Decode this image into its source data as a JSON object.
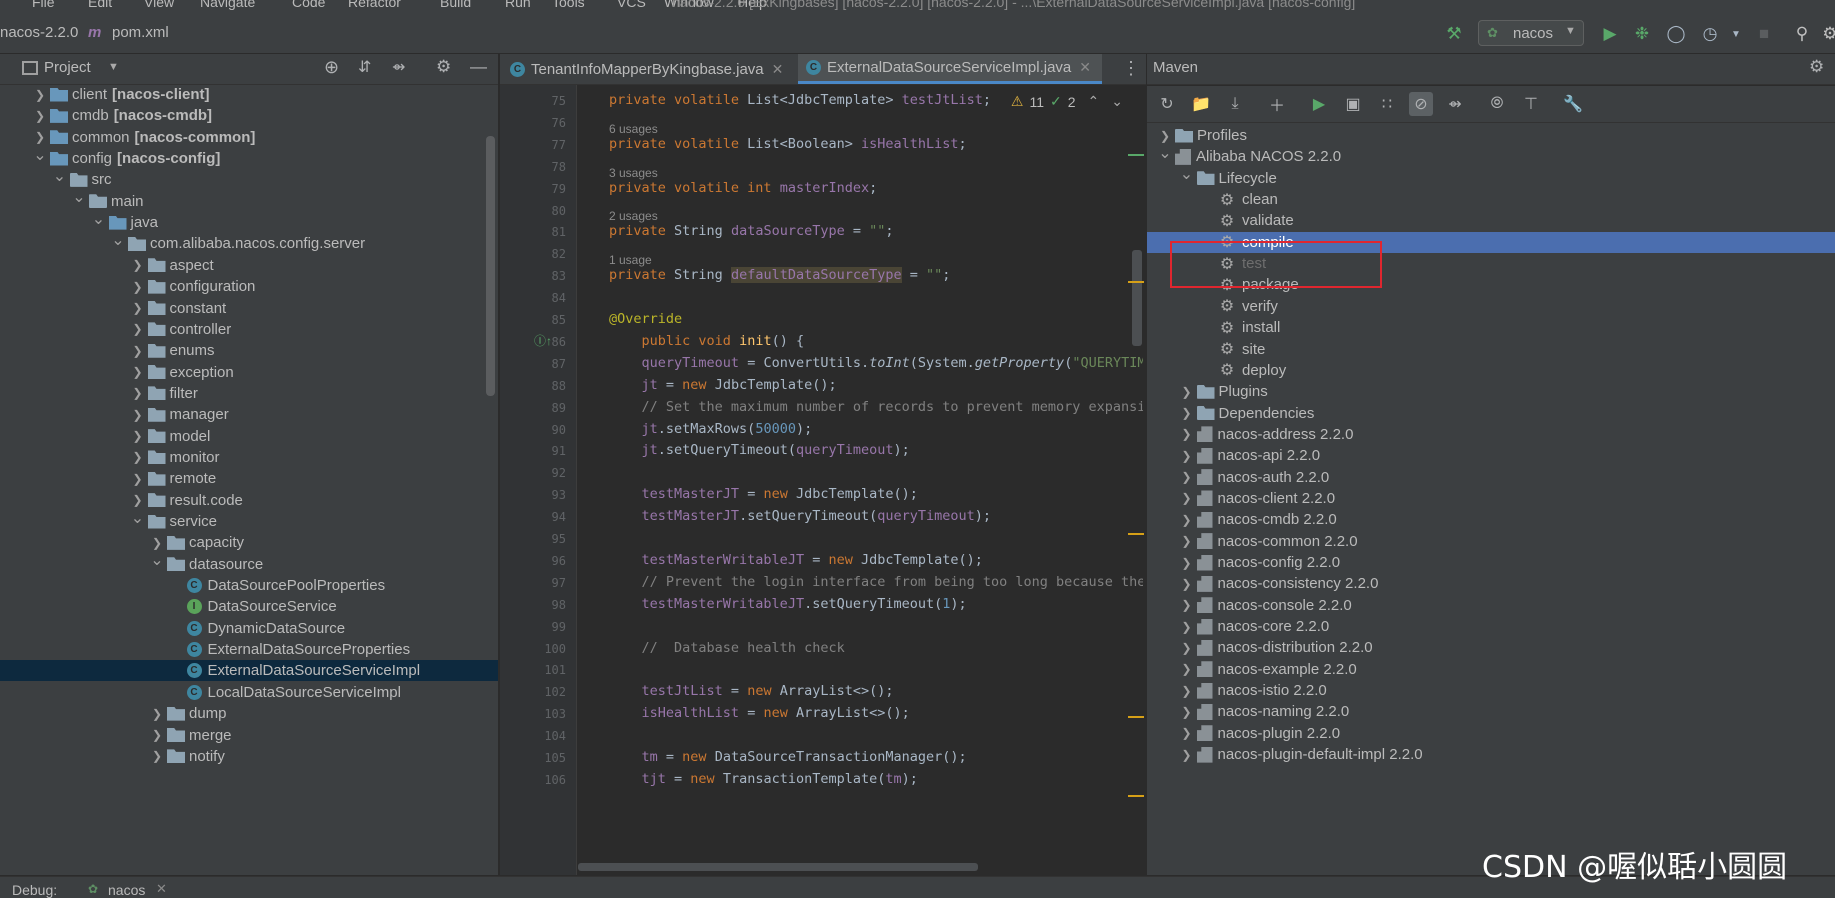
{
  "menu": [
    "File",
    "Edit",
    "View",
    "Navigate",
    "Code",
    "Refactor",
    "Build",
    "Run",
    "Tools",
    "VCS",
    "Window",
    "Help"
  ],
  "window_title": "nacos-2.2.0 [ExKingbases] [nacos-2.2.0] [nacos-2.2.0] - ...\\ExternalDataSourceServiceImpl.java [nacos-config]",
  "breadcrumb": {
    "project": "nacos-2.2.0",
    "file": "pom.xml"
  },
  "run_config": "nacos",
  "project_panel": {
    "title": "Project",
    "tree": [
      {
        "indent": 0,
        "arrow": "right",
        "icon": "folder-blue",
        "label": "client",
        "module": "[nacos-client]"
      },
      {
        "indent": 0,
        "arrow": "right",
        "icon": "folder-blue",
        "label": "cmdb",
        "module": "[nacos-cmdb]"
      },
      {
        "indent": 0,
        "arrow": "right",
        "icon": "folder-blue",
        "label": "common",
        "module": "[nacos-common]"
      },
      {
        "indent": 0,
        "arrow": "down",
        "icon": "folder-blue",
        "label": "config",
        "module": "[nacos-config]"
      },
      {
        "indent": 1,
        "arrow": "down",
        "icon": "folder",
        "label": "src"
      },
      {
        "indent": 2,
        "arrow": "down",
        "icon": "folder",
        "label": "main"
      },
      {
        "indent": 3,
        "arrow": "down",
        "icon": "folder-blue",
        "label": "java"
      },
      {
        "indent": 4,
        "arrow": "down",
        "icon": "pkg",
        "label": "com.alibaba.nacos.config.server"
      },
      {
        "indent": 5,
        "arrow": "right",
        "icon": "pkg",
        "label": "aspect"
      },
      {
        "indent": 5,
        "arrow": "right",
        "icon": "pkg",
        "label": "configuration"
      },
      {
        "indent": 5,
        "arrow": "right",
        "icon": "pkg",
        "label": "constant"
      },
      {
        "indent": 5,
        "arrow": "right",
        "icon": "pkg",
        "label": "controller"
      },
      {
        "indent": 5,
        "arrow": "right",
        "icon": "pkg",
        "label": "enums"
      },
      {
        "indent": 5,
        "arrow": "right",
        "icon": "pkg",
        "label": "exception"
      },
      {
        "indent": 5,
        "arrow": "right",
        "icon": "pkg",
        "label": "filter"
      },
      {
        "indent": 5,
        "arrow": "right",
        "icon": "pkg",
        "label": "manager"
      },
      {
        "indent": 5,
        "arrow": "right",
        "icon": "pkg",
        "label": "model"
      },
      {
        "indent": 5,
        "arrow": "right",
        "icon": "pkg",
        "label": "monitor"
      },
      {
        "indent": 5,
        "arrow": "right",
        "icon": "pkg",
        "label": "remote"
      },
      {
        "indent": 5,
        "arrow": "right",
        "icon": "pkg",
        "label": "result.code"
      },
      {
        "indent": 5,
        "arrow": "down",
        "icon": "pkg",
        "label": "service"
      },
      {
        "indent": 6,
        "arrow": "right",
        "icon": "pkg",
        "label": "capacity"
      },
      {
        "indent": 6,
        "arrow": "down",
        "icon": "pkg",
        "label": "datasource"
      },
      {
        "indent": 7,
        "arrow": "",
        "icon": "class",
        "label": "DataSourcePoolProperties"
      },
      {
        "indent": 7,
        "arrow": "",
        "icon": "interface",
        "label": "DataSourceService"
      },
      {
        "indent": 7,
        "arrow": "",
        "icon": "class",
        "label": "DynamicDataSource"
      },
      {
        "indent": 7,
        "arrow": "",
        "icon": "class",
        "label": "ExternalDataSourceProperties"
      },
      {
        "indent": 7,
        "arrow": "",
        "icon": "class",
        "label": "ExternalDataSourceServiceImpl",
        "selected": true
      },
      {
        "indent": 7,
        "arrow": "",
        "icon": "class",
        "label": "LocalDataSourceServiceImpl"
      },
      {
        "indent": 6,
        "arrow": "right",
        "icon": "pkg",
        "label": "dump"
      },
      {
        "indent": 6,
        "arrow": "right",
        "icon": "pkg",
        "label": "merge"
      },
      {
        "indent": 6,
        "arrow": "right",
        "icon": "pkg",
        "label": "notify"
      }
    ]
  },
  "editor": {
    "tabs": [
      {
        "label": "TenantInfoMapperByKingbase.java",
        "active": false
      },
      {
        "label": "ExternalDataSourceServiceImpl.java",
        "active": true
      }
    ],
    "inspections": {
      "warnings": "11",
      "checks": "2"
    },
    "lines": [
      {
        "n": "75",
        "usage": "",
        "html": "<span class='kw'>private volatile </span>List&lt;JdbcTemplate&gt; <span class='fld'>testJtList</span>;"
      },
      {
        "n": "76",
        "usage": "",
        "html": ""
      },
      {
        "n": "77",
        "usage": "6 usages",
        "html": "<span class='kw'>private volatile </span>List&lt;Boolean&gt; <span class='fld'>isHealthList</span>;"
      },
      {
        "n": "78",
        "usage": "",
        "html": ""
      },
      {
        "n": "79",
        "usage": "3 usages",
        "html": "<span class='kw'>private volatile int </span><span class='fld'>masterIndex</span>;"
      },
      {
        "n": "80",
        "usage": "",
        "html": ""
      },
      {
        "n": "81",
        "usage": "2 usages",
        "html": "<span class='kw'>private </span>String <span class='fld'>dataSourceType</span> = <span class='str'>\"\"</span>;"
      },
      {
        "n": "82",
        "usage": "",
        "html": ""
      },
      {
        "n": "83",
        "usage": "1 usage",
        "html": "<span class='kw'>private </span>String <span class='fld' style='background:#4a4535'>defaultDataSourceType</span> = <span class='str'>\"\"</span>;"
      },
      {
        "n": "84",
        "usage": "",
        "html": ""
      },
      {
        "n": "85",
        "usage": "",
        "html": "<span class='ann'>@Override</span>"
      },
      {
        "n": "86",
        "usage": "",
        "html": "    <span class='kw'>public void </span><span class='fn'>init</span>() {"
      },
      {
        "n": "87",
        "usage": "",
        "html": "    <span class='fld'>queryTimeout</span> = ConvertUtils.<span class='it'>toInt</span>(System.<span class='it'>getProperty</span>(<span class='str'>\"QUERYTIME</span>"
      },
      {
        "n": "88",
        "usage": "",
        "html": "    <span class='fld'>jt</span> = <span class='kw'>new </span>JdbcTemplate();"
      },
      {
        "n": "89",
        "usage": "",
        "html": "    <span class='cmt'>// Set the maximum number of records to prevent memory expansio</span>"
      },
      {
        "n": "90",
        "usage": "",
        "html": "    <span class='fld'>jt</span>.setMaxRows(<span class='num'>50000</span>);"
      },
      {
        "n": "91",
        "usage": "",
        "html": "    <span class='fld'>jt</span>.setQueryTimeout(<span class='fld'>queryTimeout</span>);"
      },
      {
        "n": "92",
        "usage": "",
        "html": ""
      },
      {
        "n": "93",
        "usage": "",
        "html": "    <span class='fld'>testMasterJT</span> = <span class='kw'>new </span>JdbcTemplate();"
      },
      {
        "n": "94",
        "usage": "",
        "html": "    <span class='fld'>testMasterJT</span>.setQueryTimeout(<span class='fld'>queryTimeout</span>);"
      },
      {
        "n": "95",
        "usage": "",
        "html": ""
      },
      {
        "n": "96",
        "usage": "",
        "html": "    <span class='fld'>testMasterWritableJT</span> = <span class='kw'>new </span>JdbcTemplate();"
      },
      {
        "n": "97",
        "usage": "",
        "html": "    <span class='cmt'>// Prevent the login interface from being too long because the</span>"
      },
      {
        "n": "98",
        "usage": "",
        "html": "    <span class='fld'>testMasterWritableJT</span>.setQueryTimeout(<span class='num'>1</span>);"
      },
      {
        "n": "99",
        "usage": "",
        "html": ""
      },
      {
        "n": "100",
        "usage": "",
        "html": "    <span class='cmt'>//  Database health check</span>"
      },
      {
        "n": "101",
        "usage": "",
        "html": ""
      },
      {
        "n": "102",
        "usage": "",
        "html": "    <span class='fld'>testJtList</span> = <span class='kw'>new </span>ArrayList&lt;&gt;();"
      },
      {
        "n": "103",
        "usage": "",
        "html": "    <span class='fld'>isHealthList</span> = <span class='kw'>new </span>ArrayList&lt;&gt;();"
      },
      {
        "n": "104",
        "usage": "",
        "html": ""
      },
      {
        "n": "105",
        "usage": "",
        "html": "    <span class='fld'>tm</span> = <span class='kw'>new </span>DataSourceTransactionManager();"
      },
      {
        "n": "106",
        "usage": "",
        "html": "    <span class='fld'>tjt</span> = <span class='kw'>new </span>TransactionTemplate(<span class='fld'>tm</span>);"
      }
    ]
  },
  "maven": {
    "title": "Maven",
    "tree": [
      {
        "indent": 0,
        "arrow": "right",
        "icon": "folder",
        "label": "Profiles"
      },
      {
        "indent": 0,
        "arrow": "down",
        "icon": "mvn",
        "label": "Alibaba NACOS 2.2.0"
      },
      {
        "indent": 1,
        "arrow": "down",
        "icon": "folder",
        "label": "Lifecycle"
      },
      {
        "indent": 2,
        "arrow": "",
        "icon": "gear",
        "label": "clean"
      },
      {
        "indent": 2,
        "arrow": "",
        "icon": "gear",
        "label": "validate"
      },
      {
        "indent": 2,
        "arrow": "",
        "icon": "gear",
        "label": "compile",
        "selected": true
      },
      {
        "indent": 2,
        "arrow": "",
        "icon": "gear",
        "label": "test",
        "disabled": true
      },
      {
        "indent": 2,
        "arrow": "",
        "icon": "gear",
        "label": "package"
      },
      {
        "indent": 2,
        "arrow": "",
        "icon": "gear",
        "label": "verify"
      },
      {
        "indent": 2,
        "arrow": "",
        "icon": "gear",
        "label": "install"
      },
      {
        "indent": 2,
        "arrow": "",
        "icon": "gear",
        "label": "site"
      },
      {
        "indent": 2,
        "arrow": "",
        "icon": "gear",
        "label": "deploy"
      },
      {
        "indent": 1,
        "arrow": "right",
        "icon": "folder",
        "label": "Plugins"
      },
      {
        "indent": 1,
        "arrow": "right",
        "icon": "folder",
        "label": "Dependencies"
      },
      {
        "indent": 1,
        "arrow": "right",
        "icon": "mvn",
        "label": "nacos-address 2.2.0"
      },
      {
        "indent": 1,
        "arrow": "right",
        "icon": "mvn",
        "label": "nacos-api 2.2.0"
      },
      {
        "indent": 1,
        "arrow": "right",
        "icon": "mvn",
        "label": "nacos-auth 2.2.0"
      },
      {
        "indent": 1,
        "arrow": "right",
        "icon": "mvn",
        "label": "nacos-client 2.2.0"
      },
      {
        "indent": 1,
        "arrow": "right",
        "icon": "mvn",
        "label": "nacos-cmdb 2.2.0"
      },
      {
        "indent": 1,
        "arrow": "right",
        "icon": "mvn",
        "label": "nacos-common 2.2.0"
      },
      {
        "indent": 1,
        "arrow": "right",
        "icon": "mvn",
        "label": "nacos-config 2.2.0"
      },
      {
        "indent": 1,
        "arrow": "right",
        "icon": "mvn",
        "label": "nacos-consistency 2.2.0"
      },
      {
        "indent": 1,
        "arrow": "right",
        "icon": "mvn",
        "label": "nacos-console 2.2.0"
      },
      {
        "indent": 1,
        "arrow": "right",
        "icon": "mvn",
        "label": "nacos-core 2.2.0"
      },
      {
        "indent": 1,
        "arrow": "right",
        "icon": "mvn",
        "label": "nacos-distribution 2.2.0"
      },
      {
        "indent": 1,
        "arrow": "right",
        "icon": "mvn",
        "label": "nacos-example 2.2.0"
      },
      {
        "indent": 1,
        "arrow": "right",
        "icon": "mvn",
        "label": "nacos-istio 2.2.0"
      },
      {
        "indent": 1,
        "arrow": "right",
        "icon": "mvn",
        "label": "nacos-naming 2.2.0"
      },
      {
        "indent": 1,
        "arrow": "right",
        "icon": "mvn",
        "label": "nacos-plugin 2.2.0"
      },
      {
        "indent": 1,
        "arrow": "right",
        "icon": "mvn",
        "label": "nacos-plugin-default-impl 2.2.0"
      }
    ]
  },
  "bottom": {
    "debug_label": "Debug:",
    "debug_config": "nacos"
  },
  "watermark": "CSDN @喔似聒小圆圆",
  "colors": {
    "selection": "#4b6eaf",
    "highlight_box": "#e0262f",
    "accent": "#4a88c7"
  }
}
